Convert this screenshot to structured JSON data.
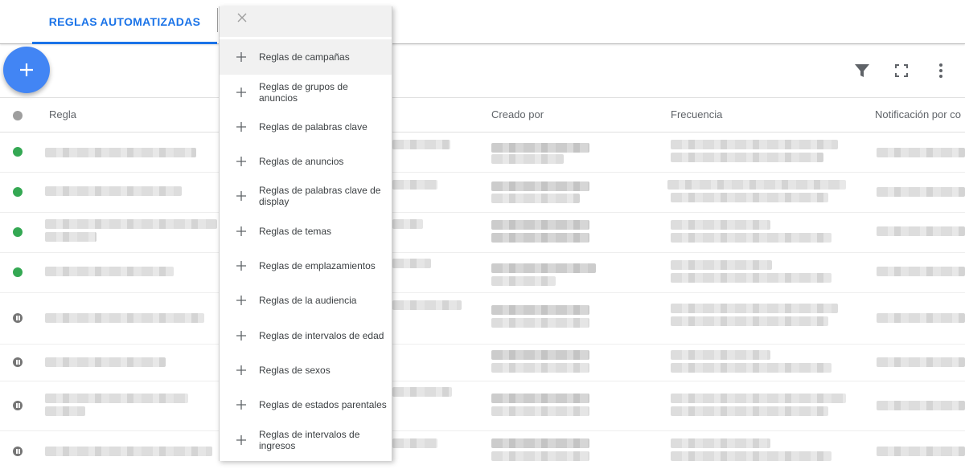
{
  "tabs": [
    {
      "label": "REGLAS AUTOMATIZADAS",
      "active": true
    }
  ],
  "fab": {
    "icon": "plus-icon"
  },
  "toolbar": {
    "icons": [
      "filter-icon",
      "fullscreen-icon",
      "more-vert-icon"
    ]
  },
  "table": {
    "columns": [
      "Regla",
      "Creado por",
      "Frecuencia",
      "Notificación por co"
    ],
    "rows": [
      {
        "status": "enabled"
      },
      {
        "status": "enabled"
      },
      {
        "status": "enabled"
      },
      {
        "status": "enabled"
      },
      {
        "status": "paused"
      },
      {
        "status": "paused"
      },
      {
        "status": "paused"
      },
      {
        "status": "paused"
      }
    ]
  },
  "menu": {
    "close_icon": "close-icon",
    "items": [
      {
        "label": "Reglas de campañas"
      },
      {
        "label": "Reglas de grupos de anuncios"
      },
      {
        "label": "Reglas de palabras clave"
      },
      {
        "label": "Reglas de anuncios"
      },
      {
        "label": "Reglas de palabras clave de display"
      },
      {
        "label": "Reglas de temas"
      },
      {
        "label": "Reglas de emplazamientos"
      },
      {
        "label": "Reglas de la audiencia"
      },
      {
        "label": "Reglas de intervalos de edad"
      },
      {
        "label": "Reglas de sexos"
      },
      {
        "label": "Reglas de estados parentales"
      },
      {
        "label": "Reglas de intervalos de ingresos"
      }
    ]
  },
  "colors": {
    "accent": "#1a73e8",
    "fab": "#4285f4",
    "enabled": "#34a853",
    "paused": "#757575"
  }
}
